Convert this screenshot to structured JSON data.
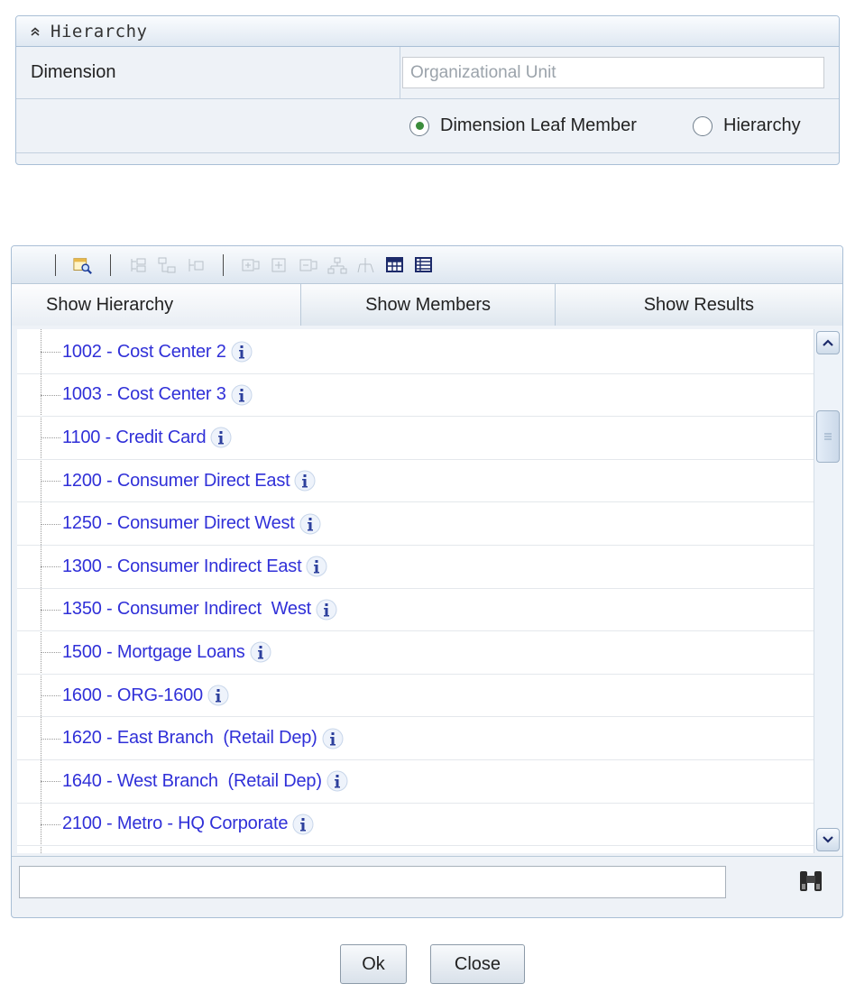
{
  "hierarchy_panel": {
    "title": "Hierarchy",
    "dimension_label": "Dimension",
    "dimension_value": "Organizational Unit",
    "radio_options": [
      {
        "label": "Dimension Leaf Member",
        "selected": true
      },
      {
        "label": "Hierarchy",
        "selected": false
      }
    ]
  },
  "browser": {
    "toolbar_icons": [
      "search-icon",
      "expand-node-icon",
      "collapse-node-icon",
      "refresh-node-icon",
      "expand-branch-icon",
      "expand-all-icon",
      "collapse-all-icon",
      "show-levels-icon",
      "hide-levels-icon",
      "grid-view-icon",
      "list-view-icon"
    ],
    "tabs": [
      {
        "label": "Show Hierarchy",
        "active": true
      },
      {
        "label": "Show Members",
        "active": false
      },
      {
        "label": "Show Results",
        "active": false
      }
    ],
    "tree_items": [
      "1002 - Cost Center 2",
      "1003 - Cost Center 3",
      "1100 - Credit Card",
      "1200 - Consumer Direct East",
      "1250 - Consumer Direct West",
      "1300 - Consumer Indirect East",
      "1350 - Consumer Indirect  West",
      "1500 - Mortgage Loans",
      "1600 - ORG-1600",
      "1620 - East Branch  (Retail Dep)",
      "1640 - West Branch  (Retail Dep)",
      "2100 - Metro - HQ Corporate"
    ],
    "search_value": ""
  },
  "buttons": {
    "ok": "Ok",
    "close": "Close"
  },
  "colors": {
    "link_text": "#3030d8",
    "panel_border": "#a9bfd6",
    "panel_bg": "#eef2f7",
    "radio_selected": "#3c8d3c"
  }
}
